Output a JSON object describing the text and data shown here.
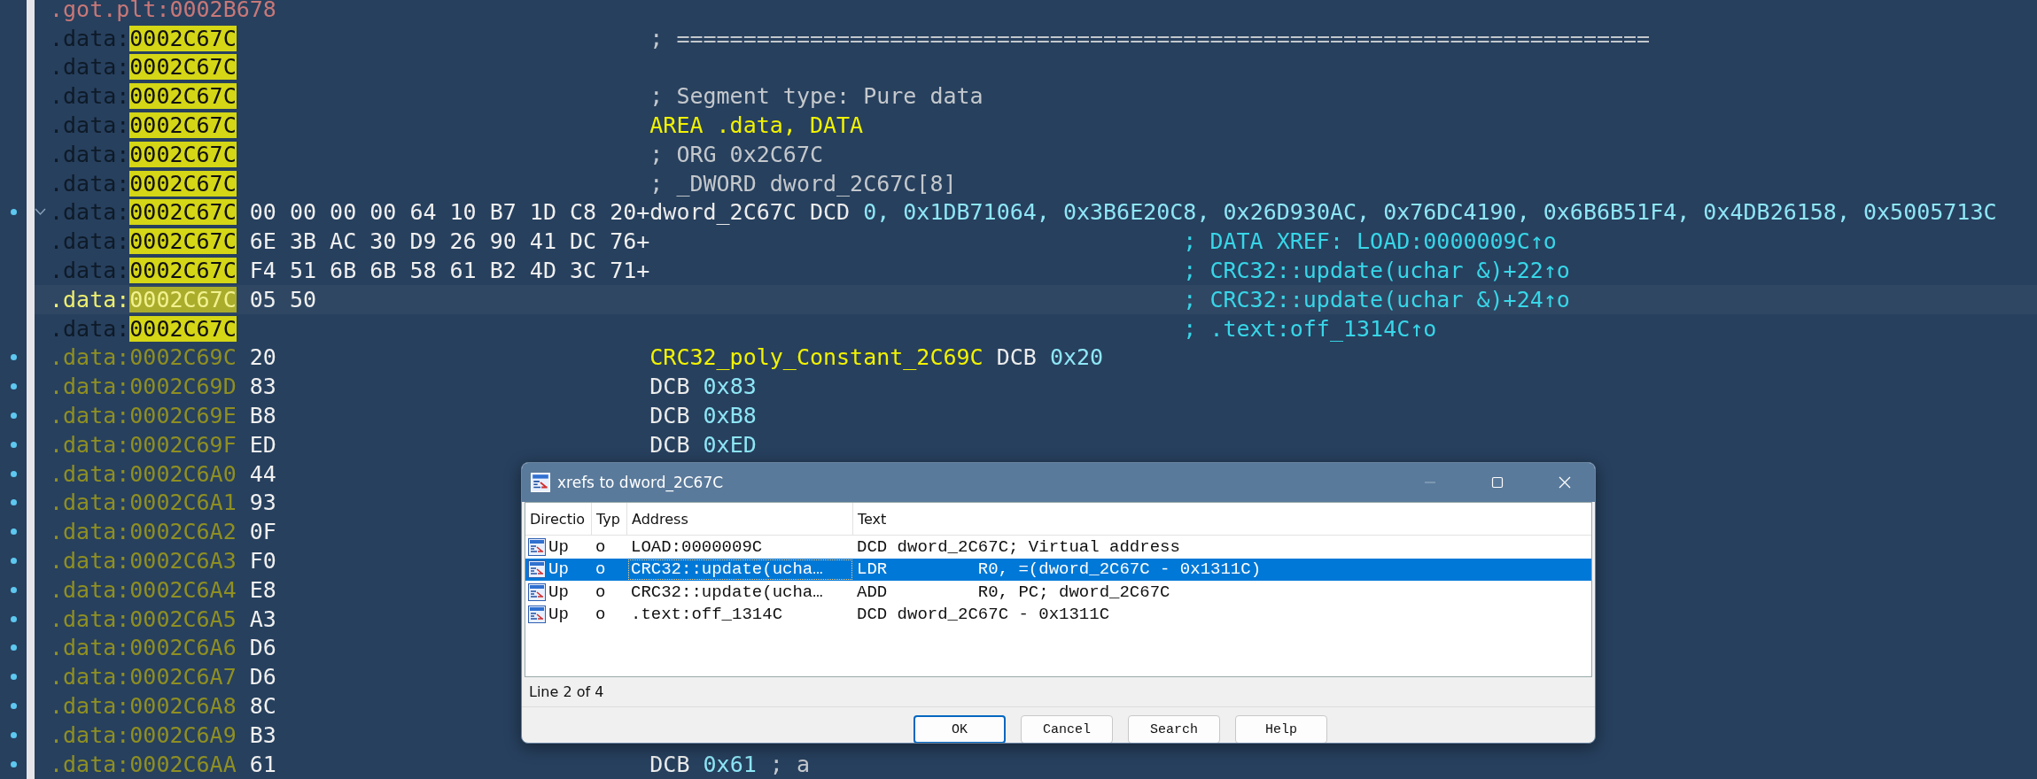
{
  "listing": {
    "rows": [
      {
        "kind": "foreign",
        "prefix": ".got.plt:",
        "address": "0002B678",
        "highlighted": false,
        "current": false,
        "marked": false,
        "collapsible": false
      },
      {
        "kind": "head",
        "prefix": ".data:",
        "address": "0002C67C",
        "highlighted": true,
        "current": false,
        "marked": false,
        "collapsible": false,
        "instruction": [
          {
            "text": "; =========================================================================",
            "kind": "comment"
          }
        ]
      },
      {
        "kind": "head",
        "prefix": ".data:",
        "address": "0002C67C",
        "highlighted": true,
        "current": false,
        "marked": false,
        "collapsible": false
      },
      {
        "kind": "head",
        "prefix": ".data:",
        "address": "0002C67C",
        "highlighted": true,
        "current": false,
        "marked": false,
        "collapsible": false,
        "instruction": [
          {
            "text": "; Segment type: Pure data",
            "kind": "comment"
          }
        ]
      },
      {
        "kind": "head",
        "prefix": ".data:",
        "address": "0002C67C",
        "highlighted": true,
        "current": false,
        "marked": false,
        "collapsible": false,
        "instruction": [
          {
            "text": "AREA .data, DATA",
            "kind": "directive"
          }
        ]
      },
      {
        "kind": "head",
        "prefix": ".data:",
        "address": "0002C67C",
        "highlighted": true,
        "current": false,
        "marked": false,
        "collapsible": false,
        "instruction": [
          {
            "text": "; ORG 0x2C67C",
            "kind": "comment"
          }
        ]
      },
      {
        "kind": "head",
        "prefix": ".data:",
        "address": "0002C67C",
        "highlighted": true,
        "current": false,
        "marked": false,
        "collapsible": false,
        "instruction": [
          {
            "text": "; _DWORD dword_2C67C[8]",
            "kind": "comment"
          }
        ]
      },
      {
        "kind": "head",
        "prefix": ".data:",
        "address": "0002C67C",
        "highlighted": true,
        "current": false,
        "marked": true,
        "collapsible": true,
        "bytes": "00 00 00 00 64 10 B7 1D C8 20+",
        "instruction": [
          {
            "text": "dword_2C67C DCD ",
            "kind": "mnemonic"
          },
          {
            "text": "0, 0x1DB71064, 0x3B6E20C8, 0x26D930AC, 0x76DC4190, 0x6B6B51F4, 0x4DB26158, 0x5005713C",
            "kind": "operand"
          }
        ]
      },
      {
        "kind": "head",
        "prefix": ".data:",
        "address": "0002C67C",
        "highlighted": true,
        "current": false,
        "marked": false,
        "collapsible": false,
        "bytes": "6E 3B AC 30 D9 26 90 41 DC 76+",
        "comment": "; DATA XREF: LOAD:0000009C↑o"
      },
      {
        "kind": "head",
        "prefix": ".data:",
        "address": "0002C67C",
        "highlighted": true,
        "current": false,
        "marked": false,
        "collapsible": false,
        "bytes": "F4 51 6B 6B 58 61 B2 4D 3C 71+",
        "comment": "; CRC32::update(uchar &)+22↑o"
      },
      {
        "kind": "head",
        "prefix": ".data:",
        "address": "0002C67C",
        "highlighted": true,
        "current": true,
        "marked": false,
        "collapsible": false,
        "bytes": "05 50",
        "comment": "; CRC32::update(uchar &)+24↑o"
      },
      {
        "kind": "head",
        "prefix": ".data:",
        "address": "0002C67C",
        "highlighted": true,
        "current": false,
        "marked": false,
        "collapsible": false,
        "comment": "; .text:off_1314C↑o"
      },
      {
        "kind": "byte",
        "prefix": ".data:",
        "address": "0002C69C",
        "highlighted": false,
        "current": false,
        "marked": true,
        "collapsible": false,
        "bytes": "20",
        "instruction": [
          {
            "text": "CRC32_poly_Constant_2C69C",
            "kind": "directive"
          },
          {
            "text": " DCB ",
            "kind": "mnemonic"
          },
          {
            "text": "0x20",
            "kind": "operand"
          }
        ]
      },
      {
        "kind": "byte",
        "prefix": ".data:",
        "address": "0002C69D",
        "highlighted": false,
        "current": false,
        "marked": true,
        "collapsible": false,
        "bytes": "83",
        "instruction": [
          {
            "text": "DCB ",
            "kind": "mnemonic"
          },
          {
            "text": "0x83",
            "kind": "operand"
          }
        ]
      },
      {
        "kind": "byte",
        "prefix": ".data:",
        "address": "0002C69E",
        "highlighted": false,
        "current": false,
        "marked": true,
        "collapsible": false,
        "bytes": "B8",
        "instruction": [
          {
            "text": "DCB ",
            "kind": "mnemonic"
          },
          {
            "text": "0xB8",
            "kind": "operand"
          }
        ]
      },
      {
        "kind": "byte",
        "prefix": ".data:",
        "address": "0002C69F",
        "highlighted": false,
        "current": false,
        "marked": true,
        "collapsible": false,
        "bytes": "ED",
        "instruction": [
          {
            "text": "DCB ",
            "kind": "mnemonic"
          },
          {
            "text": "0xED",
            "kind": "operand"
          }
        ]
      },
      {
        "kind": "byte",
        "prefix": ".data:",
        "address": "0002C6A0",
        "highlighted": false,
        "current": false,
        "marked": true,
        "collapsible": false,
        "bytes": "44"
      },
      {
        "kind": "byte",
        "prefix": ".data:",
        "address": "0002C6A1",
        "highlighted": false,
        "current": false,
        "marked": true,
        "collapsible": false,
        "bytes": "93"
      },
      {
        "kind": "byte",
        "prefix": ".data:",
        "address": "0002C6A2",
        "highlighted": false,
        "current": false,
        "marked": true,
        "collapsible": false,
        "bytes": "0F"
      },
      {
        "kind": "byte",
        "prefix": ".data:",
        "address": "0002C6A3",
        "highlighted": false,
        "current": false,
        "marked": true,
        "collapsible": false,
        "bytes": "F0"
      },
      {
        "kind": "byte",
        "prefix": ".data:",
        "address": "0002C6A4",
        "highlighted": false,
        "current": false,
        "marked": true,
        "collapsible": false,
        "bytes": "E8"
      },
      {
        "kind": "byte",
        "prefix": ".data:",
        "address": "0002C6A5",
        "highlighted": false,
        "current": false,
        "marked": true,
        "collapsible": false,
        "bytes": "A3"
      },
      {
        "kind": "byte",
        "prefix": ".data:",
        "address": "0002C6A6",
        "highlighted": false,
        "current": false,
        "marked": true,
        "collapsible": false,
        "bytes": "D6"
      },
      {
        "kind": "byte",
        "prefix": ".data:",
        "address": "0002C6A7",
        "highlighted": false,
        "current": false,
        "marked": true,
        "collapsible": false,
        "bytes": "D6"
      },
      {
        "kind": "byte",
        "prefix": ".data:",
        "address": "0002C6A8",
        "highlighted": false,
        "current": false,
        "marked": true,
        "collapsible": false,
        "bytes": "8C"
      },
      {
        "kind": "byte",
        "prefix": ".data:",
        "address": "0002C6A9",
        "highlighted": false,
        "current": false,
        "marked": true,
        "collapsible": false,
        "bytes": "B3"
      },
      {
        "kind": "byte",
        "prefix": ".data:",
        "address": "0002C6AA",
        "highlighted": false,
        "current": false,
        "marked": true,
        "collapsible": false,
        "bytes": "61",
        "instruction": [
          {
            "text": "DCB ",
            "kind": "mnemonic"
          },
          {
            "text": "0x61",
            "kind": "operand"
          },
          {
            "text": " ; a",
            "kind": "comment"
          }
        ]
      }
    ]
  },
  "xrefs_dialog": {
    "title": "xrefs to dword_2C67C",
    "columns": [
      "Directio",
      "Typ",
      "Address",
      "Text"
    ],
    "rows": [
      {
        "direction": "Up",
        "type": "o",
        "address": "LOAD:0000009C",
        "text": "DCD dword_2C67C; Virtual address",
        "selected": false
      },
      {
        "direction": "Up",
        "type": "o",
        "address": "CRC32::update(ucha…",
        "text": "LDR         R0, =(dword_2C67C - 0x1311C)",
        "selected": true
      },
      {
        "direction": "Up",
        "type": "o",
        "address": "CRC32::update(ucha…",
        "text": "ADD         R0, PC; dword_2C67C",
        "selected": false
      },
      {
        "direction": "Up",
        "type": "o",
        "address": ".text:off_1314C",
        "text": "DCD dword_2C67C - 0x1311C",
        "selected": false
      }
    ],
    "status": "Line 2 of 4",
    "buttons": [
      {
        "label": "OK",
        "default": true
      },
      {
        "label": "Cancel",
        "default": false
      },
      {
        "label": "Search",
        "default": false
      },
      {
        "label": "Help",
        "default": false
      }
    ]
  }
}
